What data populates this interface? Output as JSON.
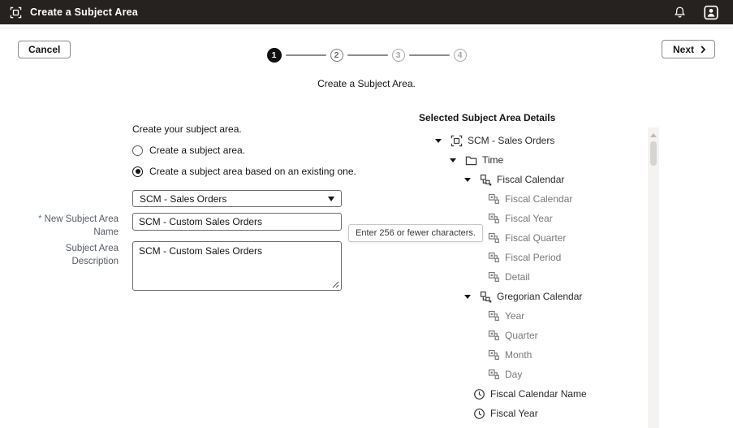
{
  "header": {
    "title": "Create a Subject Area",
    "app_icon": "subject-area-icon",
    "notifications_icon": "bell-icon",
    "account_icon": "avatar-icon",
    "bg_color": "#262220"
  },
  "toolbar": {
    "cancel_label": "Cancel",
    "next_label": "Next"
  },
  "stepper": {
    "active_step": 1,
    "steps": [
      {
        "label": "1",
        "state": "active"
      },
      {
        "label": "2",
        "state": "upcoming"
      },
      {
        "label": "3",
        "state": "distant"
      },
      {
        "label": "4",
        "state": "distant"
      }
    ]
  },
  "subtitle": "Create a Subject Area.",
  "form": {
    "section_label": "Create your subject area.",
    "radio_options": [
      {
        "label": "Create a subject area.",
        "selected": false
      },
      {
        "label": "Create a subject area based on an existing one.",
        "selected": true
      }
    ],
    "source_select": {
      "value": "SCM - Sales Orders"
    },
    "name_field": {
      "required_marker": "*",
      "label": "New Subject Area Name",
      "value": "SCM - Custom Sales Orders"
    },
    "description_field": {
      "label": "Subject Area Description",
      "value": "SCM - Custom Sales Orders"
    },
    "tooltip": "Enter 256 or fewer characters."
  },
  "tree": {
    "title": "Selected Subject Area Details",
    "items": [
      {
        "label": "SCM - Sales Orders",
        "level": 0,
        "icon": "subject-area-icon",
        "expanded": true,
        "leaf": false,
        "muted": false
      },
      {
        "label": "Time",
        "level": 1,
        "icon": "folder-icon",
        "expanded": true,
        "leaf": false,
        "muted": false
      },
      {
        "label": "Fiscal Calendar",
        "level": 2,
        "icon": "hierarchy-icon",
        "expanded": true,
        "leaf": false,
        "muted": false
      },
      {
        "label": "Fiscal Calendar",
        "level": 3,
        "icon": "level-icon",
        "expanded": false,
        "leaf": true,
        "muted": true
      },
      {
        "label": "Fiscal Year",
        "level": 3,
        "icon": "level-icon",
        "expanded": false,
        "leaf": true,
        "muted": true
      },
      {
        "label": "Fiscal Quarter",
        "level": 3,
        "icon": "level-icon",
        "expanded": false,
        "leaf": true,
        "muted": true
      },
      {
        "label": "Fiscal Period",
        "level": 3,
        "icon": "level-icon",
        "expanded": false,
        "leaf": true,
        "muted": true
      },
      {
        "label": "Detail",
        "level": 3,
        "icon": "level-icon",
        "expanded": false,
        "leaf": true,
        "muted": true
      },
      {
        "label": "Gregorian Calendar",
        "level": 2,
        "icon": "hierarchy-icon",
        "expanded": true,
        "leaf": false,
        "muted": false
      },
      {
        "label": "Year",
        "level": 3,
        "icon": "level-icon",
        "expanded": false,
        "leaf": true,
        "muted": true
      },
      {
        "label": "Quarter",
        "level": 3,
        "icon": "level-icon",
        "expanded": false,
        "leaf": true,
        "muted": true
      },
      {
        "label": "Month",
        "level": 3,
        "icon": "level-icon",
        "expanded": false,
        "leaf": true,
        "muted": true
      },
      {
        "label": "Day",
        "level": 3,
        "icon": "level-icon",
        "expanded": false,
        "leaf": true,
        "muted": true
      },
      {
        "label": "Fiscal Calendar Name",
        "level": 2,
        "icon": "clock-icon",
        "expanded": false,
        "leaf": true,
        "muted": false
      },
      {
        "label": "Fiscal Year",
        "level": 2,
        "icon": "clock-icon",
        "expanded": false,
        "leaf": true,
        "muted": false
      }
    ]
  },
  "colors": {
    "header_bg": "#262220",
    "active_step": "#100f0e",
    "muted_text": "#7a7876",
    "required_marker": "#5d7da0"
  }
}
